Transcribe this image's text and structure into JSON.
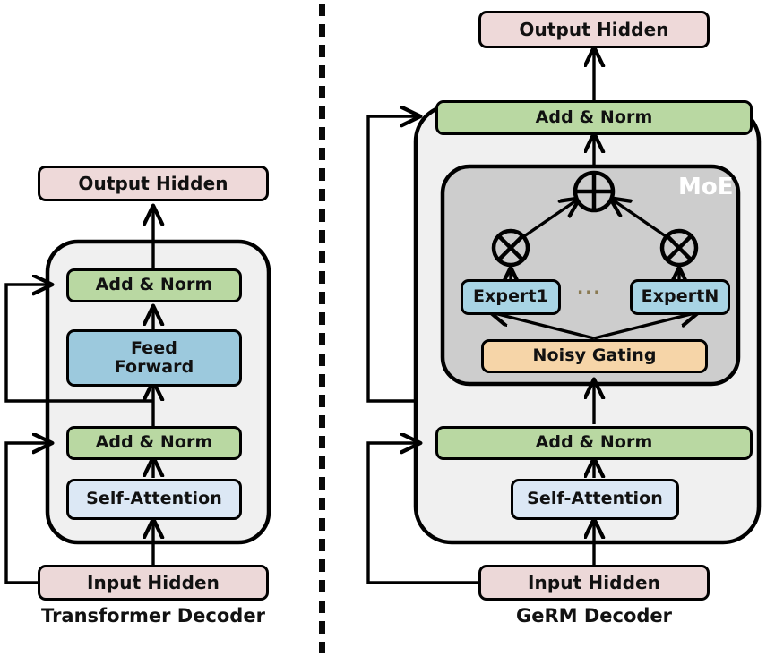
{
  "figure": {
    "title": "Transformer Decoder and GeRM Decoder architecture comparison",
    "divider": "vertical-dashed-separator"
  },
  "colors": {
    "stroke": "#000000",
    "output_hidden_fill": "#eed9d9",
    "input_hidden_fill": "#ecd8d8",
    "add_norm_fill": "#b9d8a2",
    "feed_forward_fill": "#9cc9dd",
    "self_attention_fill": "#dce8f5",
    "expert_fill": "#a8d4e4",
    "noisy_gating_fill": "#f6d5a8",
    "block_container_fill": "#f0f0f0",
    "moe_container_fill": "#cdcdcd",
    "moe_label_color": "#ffffff",
    "dots_color": "#8a7a52"
  },
  "left_panel": {
    "caption": "Transformer Decoder",
    "blocks": {
      "output_hidden": "Output Hidden",
      "add_norm_top": "Add & Norm",
      "feed_forward": "Feed\nForward",
      "feed_forward_line1": "Feed",
      "feed_forward_line2": "Forward",
      "add_norm_bottom": "Add & Norm",
      "self_attention": "Self-Attention",
      "input_hidden": "Input Hidden"
    },
    "connections": [
      {
        "name": "input-to-self-attention",
        "from": "Input Hidden",
        "to": "Self-Attention",
        "type": "arrow"
      },
      {
        "name": "self-attention-to-add-norm-bottom",
        "from": "Self-Attention",
        "to": "Add & Norm",
        "type": "arrow"
      },
      {
        "name": "add-norm-bottom-to-feed-forward",
        "from": "Add & Norm",
        "to": "Feed Forward",
        "type": "arrow"
      },
      {
        "name": "feed-forward-to-add-norm-top",
        "from": "Feed Forward",
        "to": "Add & Norm",
        "type": "arrow"
      },
      {
        "name": "add-norm-top-to-output",
        "from": "Add & Norm",
        "to": "Output Hidden",
        "type": "arrow"
      },
      {
        "name": "residual-lower",
        "from": "Input Hidden",
        "to": "Add & Norm (bottom)",
        "type": "skip-connection"
      },
      {
        "name": "residual-upper",
        "from": "Add & Norm (bottom) output",
        "to": "Add & Norm (top)",
        "type": "skip-connection"
      }
    ]
  },
  "right_panel": {
    "caption": "GeRM Decoder",
    "moe_label": "MoE",
    "ellipsis": "...",
    "blocks": {
      "output_hidden": "Output Hidden",
      "add_norm_top": "Add & Norm",
      "expert_first": "Expert1",
      "expert_last": "ExpertN",
      "noisy_gating": "Noisy Gating",
      "add_norm_bottom": "Add & Norm",
      "self_attention": "Self-Attention",
      "input_hidden": "Input Hidden"
    },
    "operators": {
      "sum": "circled-plus",
      "multiply_left": "circled-times",
      "multiply_right": "circled-times"
    },
    "connections": [
      {
        "name": "input-to-self-attention",
        "from": "Input Hidden",
        "to": "Self-Attention",
        "type": "arrow"
      },
      {
        "name": "self-attention-to-add-norm-bottom",
        "from": "Self-Attention",
        "to": "Add & Norm",
        "type": "arrow"
      },
      {
        "name": "add-norm-bottom-to-moe",
        "from": "Add & Norm",
        "to": "Noisy Gating",
        "type": "arrow"
      },
      {
        "name": "gating-to-expert1",
        "from": "Noisy Gating",
        "to": "Expert1",
        "type": "arrow"
      },
      {
        "name": "gating-to-expertn",
        "from": "Noisy Gating",
        "to": "ExpertN",
        "type": "arrow"
      },
      {
        "name": "expert1-to-multiply",
        "from": "Expert1",
        "to": "circled-times",
        "type": "arrow"
      },
      {
        "name": "expertn-to-multiply",
        "from": "ExpertN",
        "to": "circled-times",
        "type": "arrow"
      },
      {
        "name": "multiply-left-to-sum",
        "from": "circled-times",
        "to": "circled-plus",
        "type": "arrow"
      },
      {
        "name": "multiply-right-to-sum",
        "from": "circled-times",
        "to": "circled-plus",
        "type": "arrow"
      },
      {
        "name": "moe-to-add-norm-top",
        "from": "MoE",
        "to": "Add & Norm",
        "type": "arrow"
      },
      {
        "name": "add-norm-top-to-output",
        "from": "Add & Norm",
        "to": "Output Hidden",
        "type": "arrow"
      },
      {
        "name": "residual-lower",
        "from": "Input Hidden",
        "to": "Add & Norm (bottom)",
        "type": "skip-connection"
      },
      {
        "name": "residual-upper",
        "from": "Add & Norm (bottom) output",
        "to": "Add & Norm (top)",
        "type": "skip-connection"
      }
    ]
  }
}
